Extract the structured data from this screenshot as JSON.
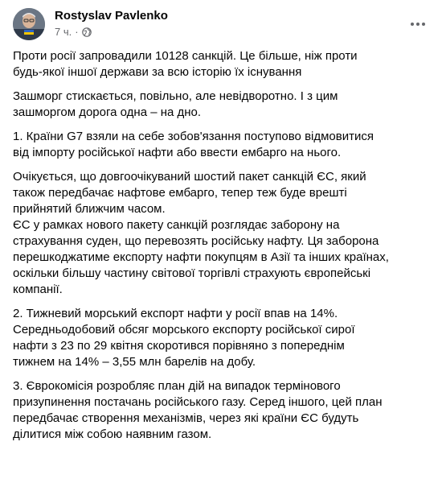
{
  "post": {
    "author": "Rostyslav Pavlenko",
    "time": "7 ч.",
    "separator": "·",
    "privacy_icon": "globe-icon",
    "more_icon": "more-horizontal-icon",
    "paragraphs": [
      {
        "lines": [
          "Проти росії запровадили 10128 санкцій. Це більше, ніж проти",
          "будь-якої іншої держави за всю історію їх існування"
        ]
      },
      {
        "lines": [
          "Зашморг стискається, повільно, але невідворотно. І з цим",
          "зашморгом дорога одна – на дно."
        ]
      },
      {
        "lines": [
          "1. Країни G7 взяли на себе зобов'язання поступово відмовитися",
          "від імпорту російської нафти або ввести ембарго на нього."
        ]
      },
      {
        "lines": [
          "Очікується, що довгоочікуваний шостий пакет санкцій ЄС, який",
          "також передбачає нафтове ембарго, тепер теж буде врешті",
          "прийнятий ближчим часом.",
          "ЄС у рамках нового пакету санкцій розглядає заборону на",
          "страхування суден, що перевозять російську нафту. Ця заборона",
          "перешкоджатиме експорту нафти покупцям в Азії та інших країнах,",
          "оскільки більшу частину світової торгівлі страхують європейські",
          "компанії."
        ]
      },
      {
        "lines": [
          "2. Тижневий морський експорт нафти у росії впав на 14%.",
          "Середньодобовий обсяг морського експорту російської сирої",
          "нафти з 23 по 29 квітня скоротився порівняно з попереднім",
          "тижнем на 14% – 3,55 млн барелів на добу."
        ]
      },
      {
        "lines": [
          "3. Єврокомісія розробляє план дій на випадок термінового",
          "призупинення постачань російського газу. Серед іншого, цей план",
          "передбачає створення механізмів, через які країни ЄС будуть",
          "ділитися між собою наявним газом."
        ]
      }
    ]
  },
  "colors": {
    "text": "#050505",
    "secondary": "#65676b",
    "background": "#ffffff"
  }
}
